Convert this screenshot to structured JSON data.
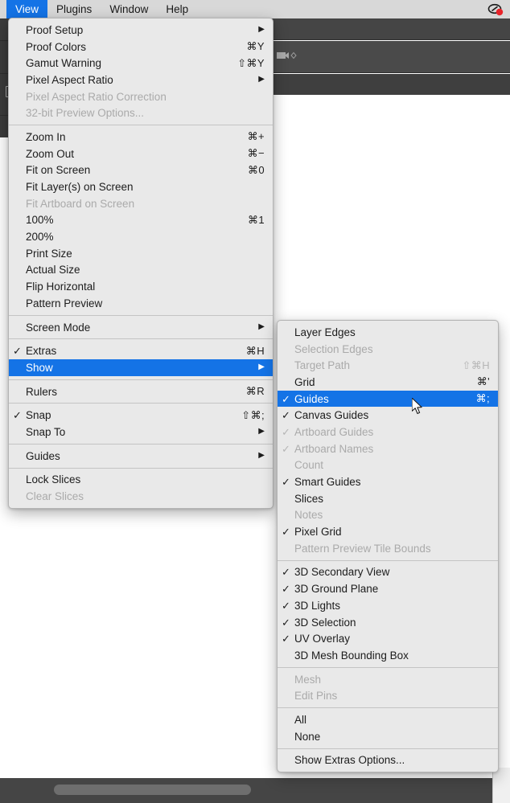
{
  "menubar": {
    "items": [
      {
        "label": "View",
        "active": true
      },
      {
        "label": "Plugins",
        "active": false
      },
      {
        "label": "Window",
        "active": false
      },
      {
        "label": "Help",
        "active": false
      }
    ],
    "status_icon": "screen-record-icon"
  },
  "toolbar": {
    "video_icon": "video-camera-icon",
    "tool_icon": "crop-tool-icon"
  },
  "view_menu": {
    "groups": [
      {
        "items": [
          {
            "label": "Proof Setup",
            "check": "",
            "accel": "",
            "arrow": true,
            "disabled": false,
            "selected": false
          },
          {
            "label": "Proof Colors",
            "check": "",
            "accel": "⌘Y",
            "arrow": false,
            "disabled": false,
            "selected": false
          },
          {
            "label": "Gamut Warning",
            "check": "",
            "accel": "⇧⌘Y",
            "arrow": false,
            "disabled": false,
            "selected": false
          },
          {
            "label": "Pixel Aspect Ratio",
            "check": "",
            "accel": "",
            "arrow": true,
            "disabled": false,
            "selected": false
          },
          {
            "label": "Pixel Aspect Ratio Correction",
            "check": "",
            "accel": "",
            "arrow": false,
            "disabled": true,
            "selected": false
          },
          {
            "label": "32-bit Preview Options...",
            "check": "",
            "accel": "",
            "arrow": false,
            "disabled": true,
            "selected": false
          }
        ]
      },
      {
        "items": [
          {
            "label": "Zoom In",
            "check": "",
            "accel": "⌘+",
            "arrow": false,
            "disabled": false,
            "selected": false
          },
          {
            "label": "Zoom Out",
            "check": "",
            "accel": "⌘−",
            "arrow": false,
            "disabled": false,
            "selected": false
          },
          {
            "label": "Fit on Screen",
            "check": "",
            "accel": "⌘0",
            "arrow": false,
            "disabled": false,
            "selected": false
          },
          {
            "label": "Fit Layer(s) on Screen",
            "check": "",
            "accel": "",
            "arrow": false,
            "disabled": false,
            "selected": false
          },
          {
            "label": "Fit Artboard on Screen",
            "check": "",
            "accel": "",
            "arrow": false,
            "disabled": true,
            "selected": false
          },
          {
            "label": "100%",
            "check": "",
            "accel": "⌘1",
            "arrow": false,
            "disabled": false,
            "selected": false
          },
          {
            "label": "200%",
            "check": "",
            "accel": "",
            "arrow": false,
            "disabled": false,
            "selected": false
          },
          {
            "label": "Print Size",
            "check": "",
            "accel": "",
            "arrow": false,
            "disabled": false,
            "selected": false
          },
          {
            "label": "Actual Size",
            "check": "",
            "accel": "",
            "arrow": false,
            "disabled": false,
            "selected": false
          },
          {
            "label": "Flip Horizontal",
            "check": "",
            "accel": "",
            "arrow": false,
            "disabled": false,
            "selected": false
          },
          {
            "label": "Pattern Preview",
            "check": "",
            "accel": "",
            "arrow": false,
            "disabled": false,
            "selected": false
          }
        ]
      },
      {
        "items": [
          {
            "label": "Screen Mode",
            "check": "",
            "accel": "",
            "arrow": true,
            "disabled": false,
            "selected": false
          }
        ]
      },
      {
        "items": [
          {
            "label": "Extras",
            "check": "✓",
            "accel": "⌘H",
            "arrow": false,
            "disabled": false,
            "selected": false
          },
          {
            "label": "Show",
            "check": "",
            "accel": "",
            "arrow": true,
            "disabled": false,
            "selected": true
          }
        ]
      },
      {
        "items": [
          {
            "label": "Rulers",
            "check": "",
            "accel": "⌘R",
            "arrow": false,
            "disabled": false,
            "selected": false
          }
        ]
      },
      {
        "items": [
          {
            "label": "Snap",
            "check": "✓",
            "accel": "⇧⌘;",
            "arrow": false,
            "disabled": false,
            "selected": false
          },
          {
            "label": "Snap To",
            "check": "",
            "accel": "",
            "arrow": true,
            "disabled": false,
            "selected": false
          }
        ]
      },
      {
        "items": [
          {
            "label": "Guides",
            "check": "",
            "accel": "",
            "arrow": true,
            "disabled": false,
            "selected": false
          }
        ]
      },
      {
        "items": [
          {
            "label": "Lock Slices",
            "check": "",
            "accel": "",
            "arrow": false,
            "disabled": false,
            "selected": false
          },
          {
            "label": "Clear Slices",
            "check": "",
            "accel": "",
            "arrow": false,
            "disabled": true,
            "selected": false
          }
        ]
      }
    ]
  },
  "show_submenu": {
    "groups": [
      {
        "items": [
          {
            "label": "Layer Edges",
            "check": "",
            "accel": "",
            "disabled": false,
            "selected": false
          },
          {
            "label": "Selection Edges",
            "check": "",
            "accel": "",
            "disabled": true,
            "selected": false
          },
          {
            "label": "Target Path",
            "check": "",
            "accel": "⇧⌘H",
            "disabled": true,
            "selected": false
          },
          {
            "label": "Grid",
            "check": "",
            "accel": "⌘'",
            "disabled": false,
            "selected": false
          },
          {
            "label": "Guides",
            "check": "✓",
            "accel": "⌘;",
            "disabled": false,
            "selected": true
          },
          {
            "label": "Canvas Guides",
            "check": "✓",
            "accel": "",
            "disabled": false,
            "selected": false
          },
          {
            "label": "Artboard Guides",
            "check": "✓",
            "accel": "",
            "disabled": true,
            "selected": false
          },
          {
            "label": "Artboard Names",
            "check": "✓",
            "accel": "",
            "disabled": true,
            "selected": false
          },
          {
            "label": "Count",
            "check": "",
            "accel": "",
            "disabled": true,
            "selected": false
          },
          {
            "label": "Smart Guides",
            "check": "✓",
            "accel": "",
            "disabled": false,
            "selected": false
          },
          {
            "label": "Slices",
            "check": "",
            "accel": "",
            "disabled": false,
            "selected": false
          },
          {
            "label": "Notes",
            "check": "",
            "accel": "",
            "disabled": true,
            "selected": false
          },
          {
            "label": "Pixel Grid",
            "check": "✓",
            "accel": "",
            "disabled": false,
            "selected": false
          },
          {
            "label": "Pattern Preview Tile Bounds",
            "check": "",
            "accel": "",
            "disabled": true,
            "selected": false
          }
        ]
      },
      {
        "items": [
          {
            "label": "3D Secondary View",
            "check": "✓",
            "accel": "",
            "disabled": false,
            "selected": false
          },
          {
            "label": "3D Ground Plane",
            "check": "✓",
            "accel": "",
            "disabled": false,
            "selected": false
          },
          {
            "label": "3D Lights",
            "check": "✓",
            "accel": "",
            "disabled": false,
            "selected": false
          },
          {
            "label": "3D Selection",
            "check": "✓",
            "accel": "",
            "disabled": false,
            "selected": false
          },
          {
            "label": "UV Overlay",
            "check": "✓",
            "accel": "",
            "disabled": false,
            "selected": false
          },
          {
            "label": "3D Mesh Bounding Box",
            "check": "",
            "accel": "",
            "disabled": false,
            "selected": false
          }
        ]
      },
      {
        "items": [
          {
            "label": "Mesh",
            "check": "",
            "accel": "",
            "disabled": true,
            "selected": false
          },
          {
            "label": "Edit Pins",
            "check": "",
            "accel": "",
            "disabled": true,
            "selected": false
          }
        ]
      },
      {
        "items": [
          {
            "label": "All",
            "check": "",
            "accel": "",
            "disabled": false,
            "selected": false
          },
          {
            "label": "None",
            "check": "",
            "accel": "",
            "disabled": false,
            "selected": false
          }
        ]
      },
      {
        "items": [
          {
            "label": "Show Extras Options...",
            "check": "",
            "accel": "",
            "disabled": false,
            "selected": false
          }
        ]
      }
    ]
  },
  "colors": {
    "accent": "#1473e6",
    "menu_bg": "#e9e9e9",
    "menubar_bg": "#d8d8d8",
    "disabled_text": "#aaaaaa",
    "text": "#1c1c1c"
  }
}
